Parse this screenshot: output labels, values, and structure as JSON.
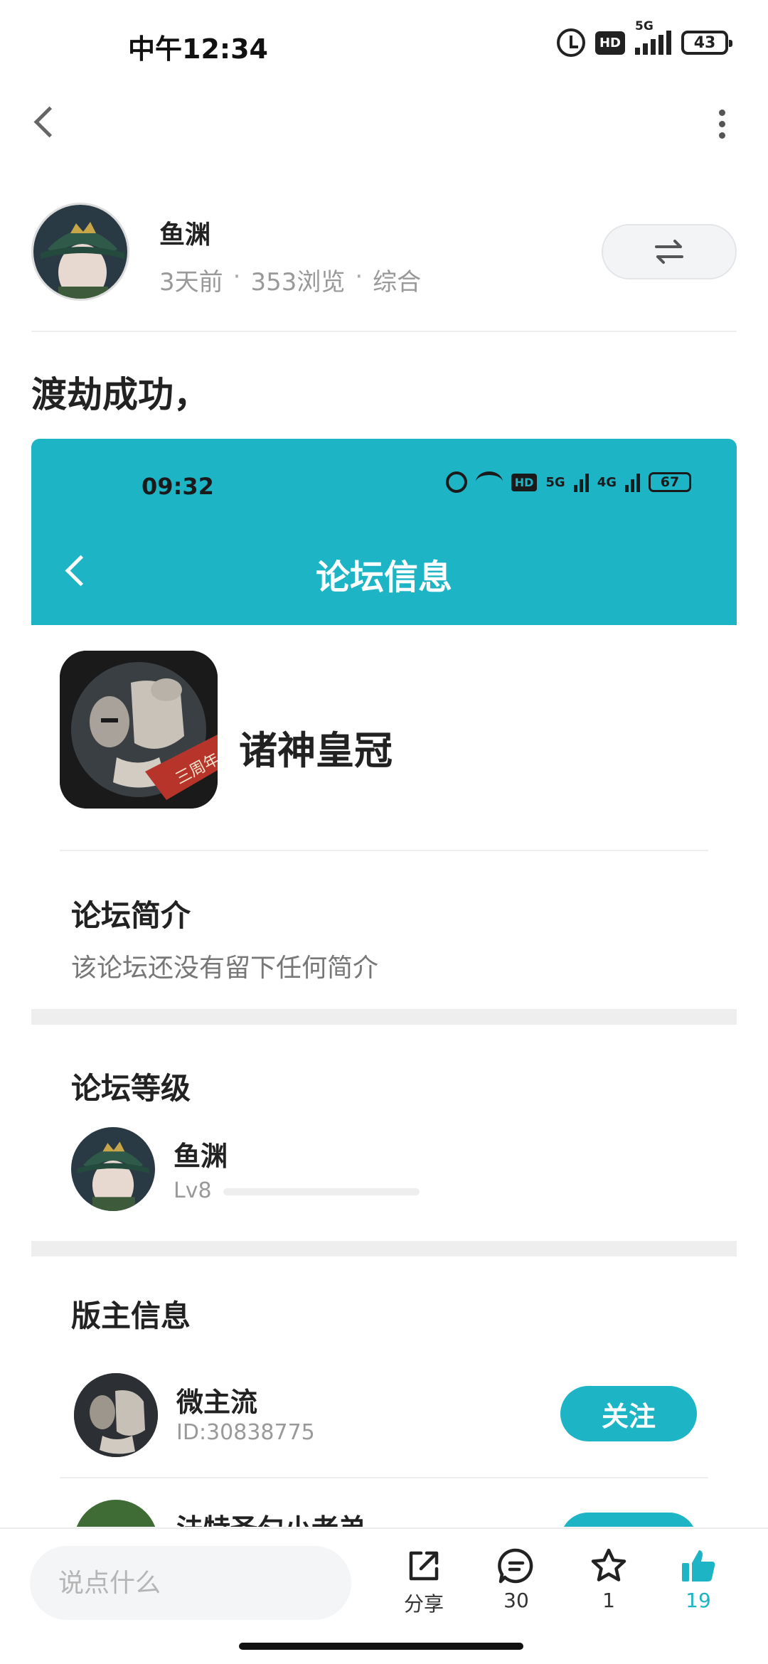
{
  "status_bar": {
    "time": "中午12:34",
    "hd": "HD",
    "network": "5G",
    "battery": "43"
  },
  "author": {
    "name": "鱼渊",
    "time_ago": "3天前",
    "views": "353浏览",
    "category": "综合"
  },
  "post": {
    "title": "渡劫成功，"
  },
  "screenshot": {
    "status_time": "09:32",
    "hd": "HD",
    "net1": "5G",
    "net2": "4G",
    "battery": "67",
    "header_title": "论坛信息",
    "forum_name": "诸神皇冠",
    "forum_badge": "三周年",
    "intro_title": "论坛简介",
    "intro_text": "该论坛还没有留下任何简介",
    "level_title": "论坛等级",
    "level_user": "鱼渊",
    "level": "Lv8",
    "level_progress": 0.0,
    "mods_title": "版主信息",
    "moderators": [
      {
        "name": "微主流",
        "id": "ID:30838775",
        "follow": "关注"
      },
      {
        "name": "法特圣匀小老弟",
        "id": "",
        "follow": "关注"
      }
    ]
  },
  "bottom": {
    "comment_placeholder": "说点什么",
    "share_label": "分享",
    "comments": "30",
    "favorites": "1",
    "likes": "19"
  },
  "colors": {
    "accent": "#1db5c6",
    "header": "#1db5c6"
  },
  "icons": [
    "back-icon",
    "more-icon",
    "swap-icon",
    "share-icon",
    "comment-icon",
    "star-icon",
    "thumbs-up-icon"
  ]
}
